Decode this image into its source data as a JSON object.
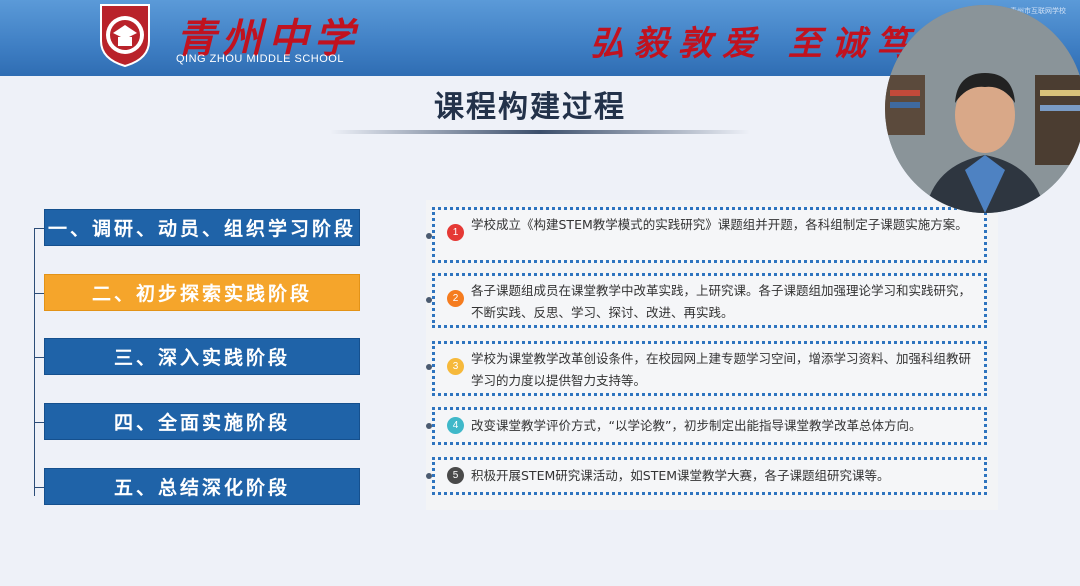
{
  "header": {
    "school_name": "青州中学",
    "school_name_en": "QING ZHOU MIDDLE SCHOOL",
    "motto": "弘毅敦爱  至诚笃",
    "watermark": "青州市互联网学校"
  },
  "page_title": "课程构建过程",
  "stages": [
    {
      "label": "一、调研、动员、组织学习阶段",
      "active": false
    },
    {
      "label": "二、初步探索实践阶段",
      "active": true
    },
    {
      "label": "三、深入实践阶段",
      "active": false
    },
    {
      "label": "四、全面实施阶段",
      "active": false
    },
    {
      "label": "五、总结深化阶段",
      "active": false
    }
  ],
  "items": [
    {
      "num": "1",
      "color": "#e53935",
      "text": "学校成立《构建STEM教学模式的实践研究》课题组并开题，各科组制定子课题实施方案。"
    },
    {
      "num": "2",
      "color": "#f57c1f",
      "text": "各子课题组成员在课堂教学中改革实践，上研究课。各子课题组加强理论学习和实践研究，不断实践、反思、学习、探讨、改进、再实践。"
    },
    {
      "num": "3",
      "color": "#f6b93b",
      "text": "学校为课堂教学改革创设条件，在校园网上建专题学习空间，增添学习资料、加强科组教研学习的力度以提供智力支持等。"
    },
    {
      "num": "4",
      "color": "#3fb8c9",
      "text": "改变课堂教学评价方式，“以学论教”，初步制定出能指导课堂教学改革总体方向。"
    },
    {
      "num": "5",
      "color": "#4a4a4a",
      "text": "积极开展STEM研究课活动，如STEM课堂教学大赛，各子课题组研究课等。"
    }
  ]
}
